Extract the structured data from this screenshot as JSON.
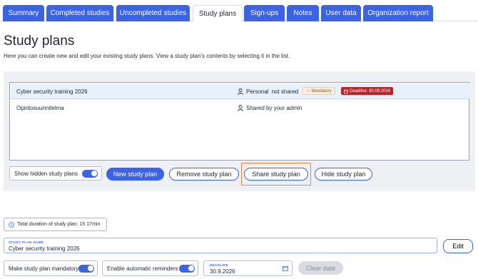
{
  "tabs": [
    {
      "label": "Summary",
      "active": false
    },
    {
      "label": "Completed studies",
      "active": false
    },
    {
      "label": "Uncompleted studies",
      "active": false
    },
    {
      "label": "Study plans",
      "active": true
    },
    {
      "label": "Sign-ups",
      "active": false
    },
    {
      "label": "Notes",
      "active": false
    },
    {
      "label": "User data",
      "active": false
    },
    {
      "label": "Organization report",
      "active": false
    }
  ],
  "page": {
    "title": "Study plans",
    "description": "Here you can create new and edit your existing study plans. View a study plan's contents by selecting it in the list."
  },
  "plans": [
    {
      "name": "Cyber security training 2026",
      "owner": "Personal",
      "sharing": "not shared",
      "mandatory_label": "Mandatory",
      "deadline_label": "Deadline: 30.09.2026",
      "selected": true
    },
    {
      "name": "Opintosuunnitelma",
      "owner": "Shared by your admin",
      "selected": false
    }
  ],
  "actions": {
    "show_hidden_label": "Show hidden study plans",
    "show_hidden_on": true,
    "new_label": "New study plan",
    "remove_label": "Remove study plan",
    "share_label": "Share study plan",
    "hide_label": "Hide study plan"
  },
  "details": {
    "duration_text": "Total duration of study plan: 1h 17min",
    "name_label": "STUDY PLAN NAME",
    "name_value": "Cyber security training 2026",
    "edit_label": "Edit",
    "mandatory_toggle_label": "Make study plan mandatory",
    "mandatory_on": true,
    "reminders_toggle_label": "Enable automatic reminders",
    "reminders_on": true,
    "deadline_label": "DEADLINE",
    "deadline_value": "30.9.2026",
    "clear_date_label": "Clear date"
  },
  "colors": {
    "accent": "#3b63e6",
    "selected_row": "#e7f0fb",
    "deadline_badge": "#b5262b",
    "highlight_outline": "#e9893e"
  },
  "icons": {
    "person": "person-icon",
    "star": "star-icon",
    "calendar": "calendar-icon",
    "clock": "clock-icon"
  }
}
